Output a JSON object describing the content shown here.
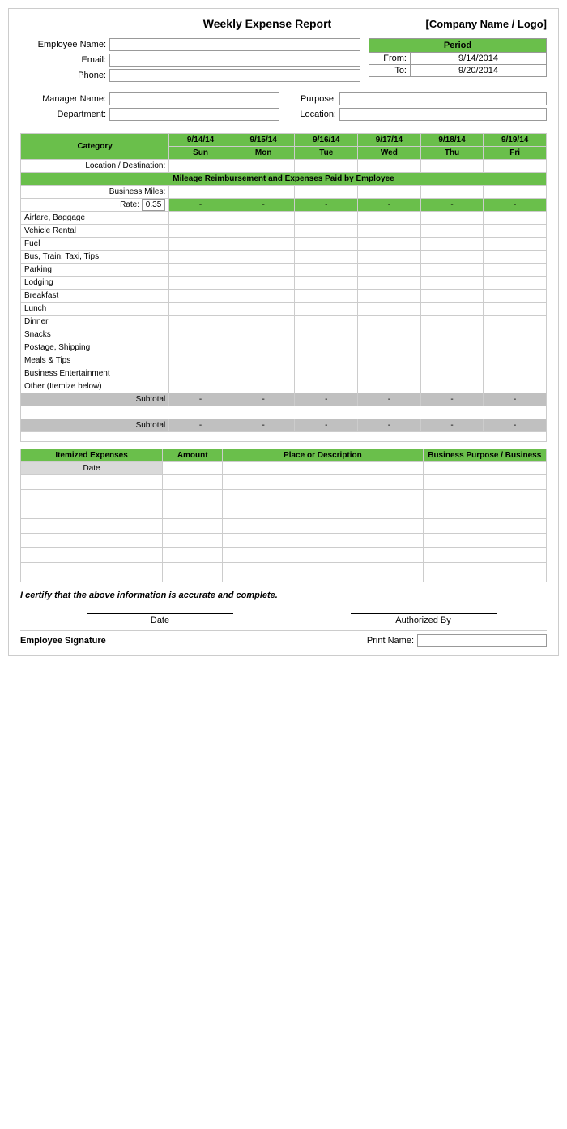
{
  "header": {
    "title": "Weekly Expense Report",
    "company": "[Company Name / Logo]"
  },
  "employee": {
    "name_label": "Employee Name:",
    "email_label": "Email:",
    "phone_label": "Phone:",
    "name_value": "",
    "email_value": "",
    "phone_value": ""
  },
  "period": {
    "label": "Period",
    "from_label": "From:",
    "to_label": "To:",
    "from_date": "9/14/2014",
    "to_date": "9/20/2014"
  },
  "manager": {
    "name_label": "Manager Name:",
    "dept_label": "Department:",
    "purpose_label": "Purpose:",
    "location_label": "Location:"
  },
  "table": {
    "category_label": "Category",
    "dates": [
      "9/14/14",
      "9/15/14",
      "9/16/14",
      "9/17/14",
      "9/18/14",
      "9/19/14"
    ],
    "days": [
      "Sun",
      "Mon",
      "Tue",
      "Wed",
      "Thu",
      "Fri"
    ],
    "location_label": "Location / Destination:",
    "mileage_header": "Mileage Reimbursement and Expenses Paid by Employee",
    "business_miles_label": "Business Miles:",
    "rate_label": "Rate:",
    "rate_value": "0.35",
    "dash": "-",
    "rows": [
      "Airfare, Baggage",
      "Vehicle Rental",
      "Fuel",
      "Bus, Train, Taxi, Tips",
      "Parking",
      "Lodging",
      "Breakfast",
      "Lunch",
      "Dinner",
      "Snacks",
      "Postage, Shipping",
      "Meals & Tips",
      "Business Entertainment",
      "Other (Itemize below)"
    ],
    "subtotal_label": "Subtotal"
  },
  "itemized": {
    "header": "Itemized Expenses",
    "amount_col": "Amount",
    "place_col": "Place or Description",
    "purpose_col": "Business Purpose / Business",
    "date_label": "Date"
  },
  "certification": {
    "text": "I certify that the above information is accurate and complete."
  },
  "signatures": {
    "date_label": "Date",
    "authorized_label": "Authorized By",
    "emp_sig_label": "Employee Signature",
    "print_name_label": "Print Name:"
  }
}
